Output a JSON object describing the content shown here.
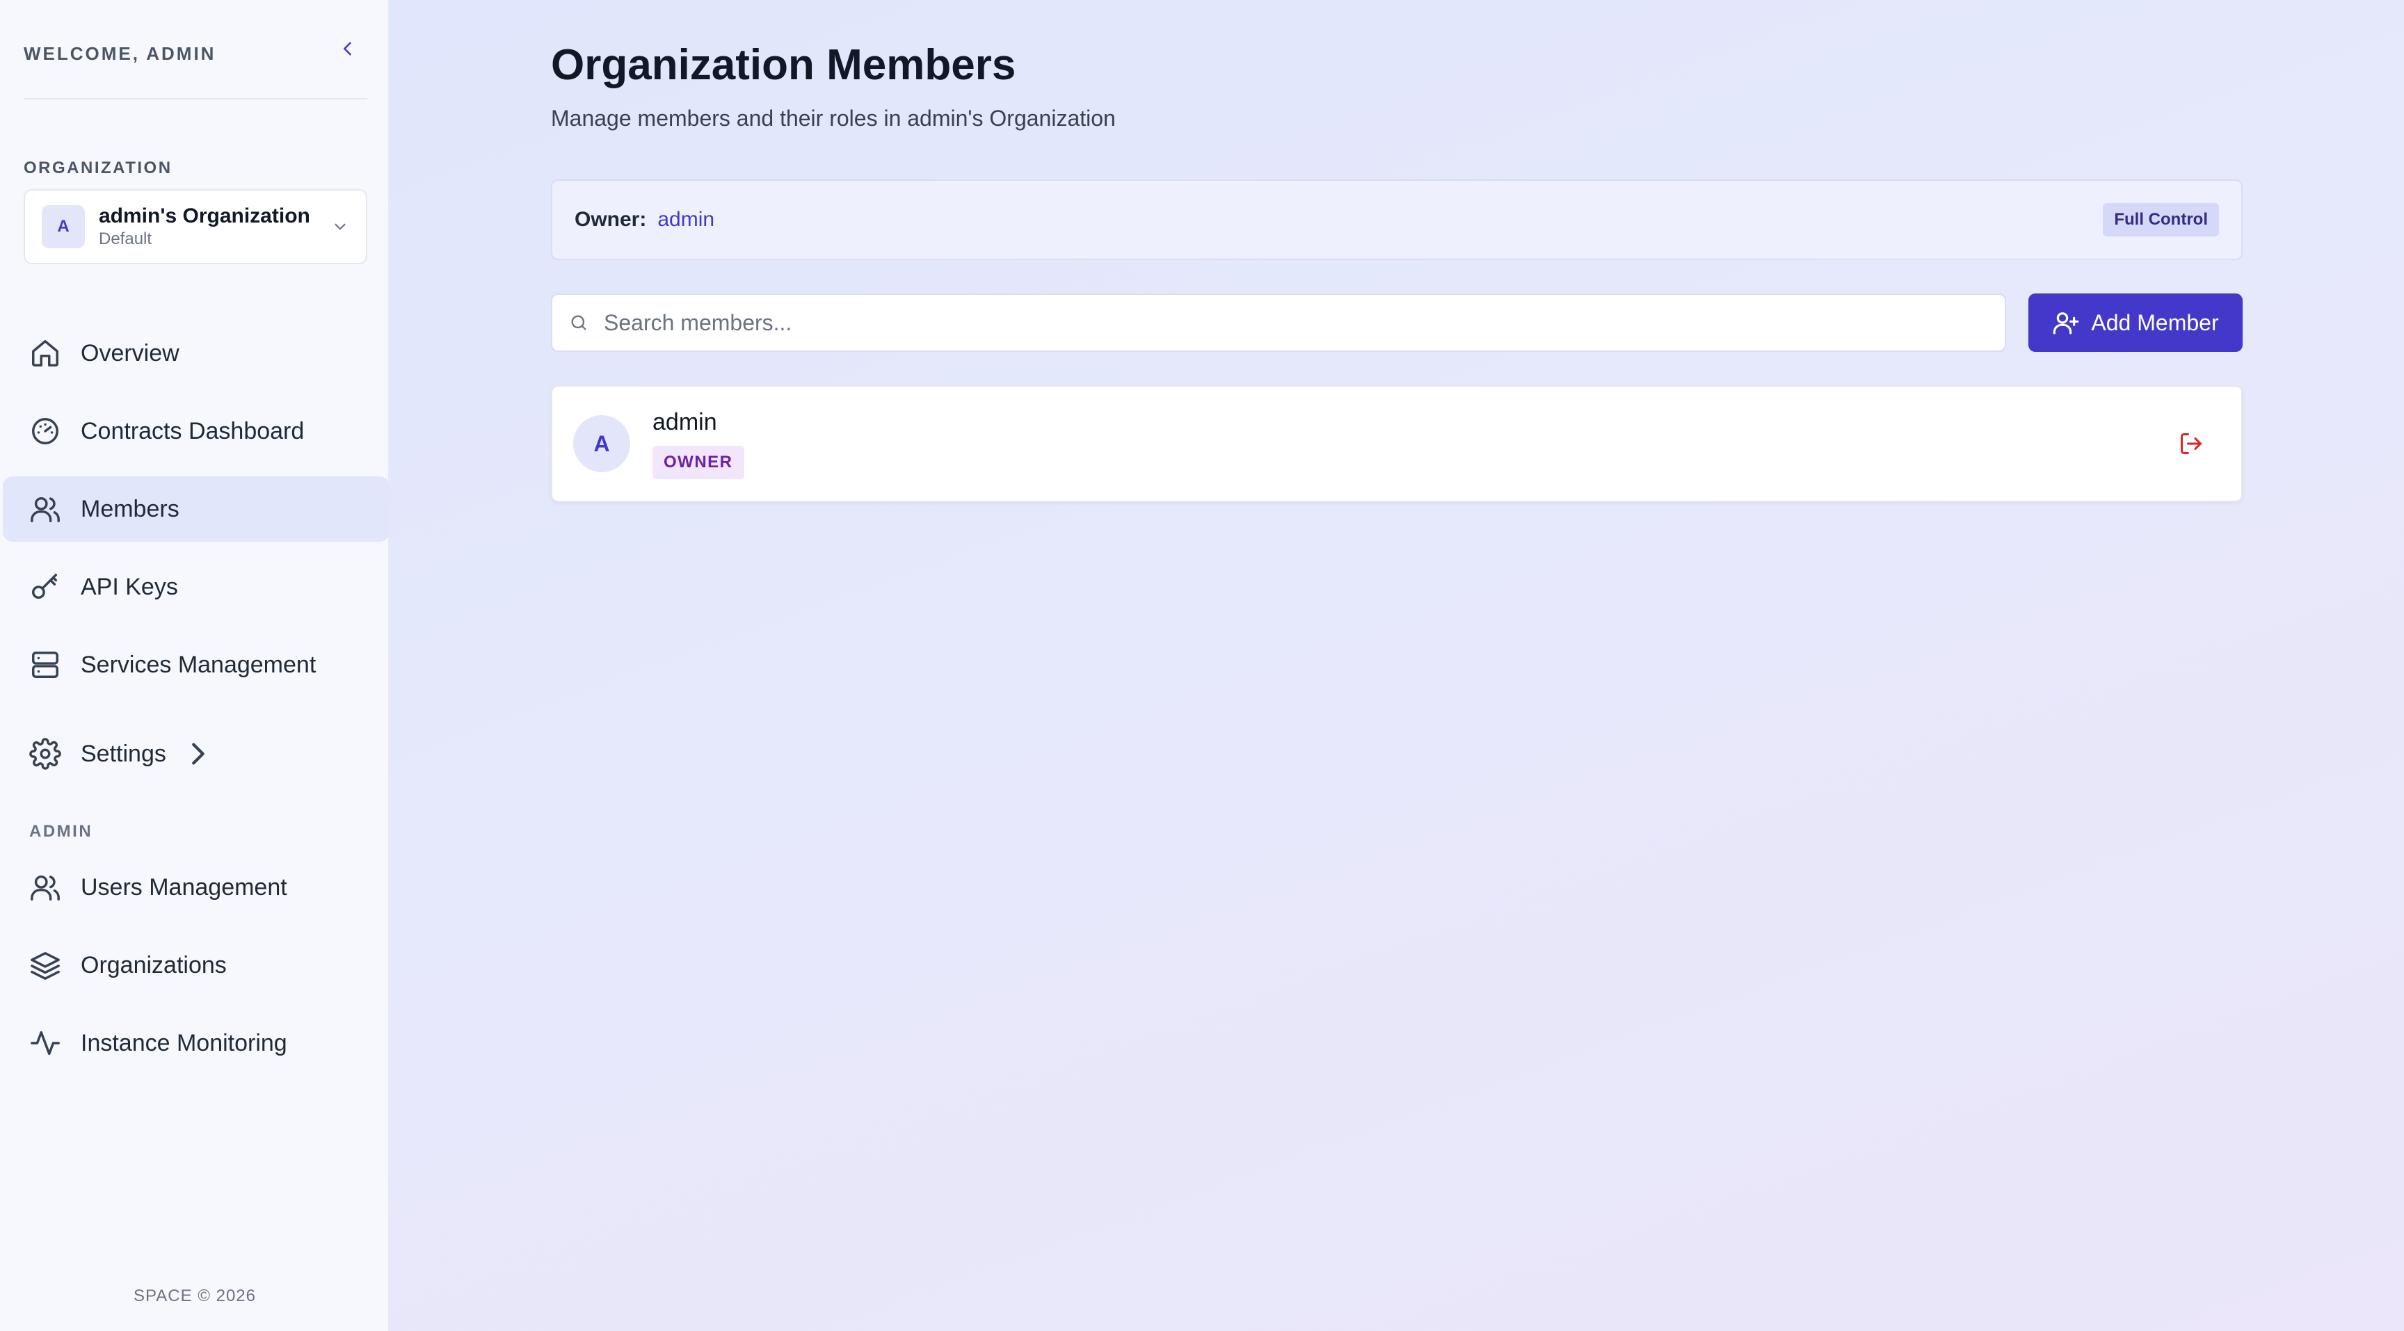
{
  "sidebar": {
    "welcome": "WELCOME, ADMIN",
    "organization_label": "ORGANIZATION",
    "organization": {
      "avatar_letter": "A",
      "name": "admin's Organization",
      "sub": "Default"
    },
    "nav": [
      {
        "label": "Overview",
        "icon": "home-icon"
      },
      {
        "label": "Contracts Dashboard",
        "icon": "gauge-icon"
      },
      {
        "label": "Members",
        "icon": "users-icon",
        "active": true
      },
      {
        "label": "API Keys",
        "icon": "key-icon"
      },
      {
        "label": "Services Management",
        "icon": "server-icon"
      },
      {
        "label": "Settings",
        "icon": "gear-icon"
      }
    ],
    "admin_label": "ADMIN",
    "admin_nav": [
      {
        "label": "Users Management",
        "icon": "users-icon"
      },
      {
        "label": "Organizations",
        "icon": "layers-icon"
      },
      {
        "label": "Instance Monitoring",
        "icon": "activity-icon"
      }
    ],
    "footer": "SPACE © 2026"
  },
  "main": {
    "title": "Organization Members",
    "subtitle": "Manage members and their roles in admin's Organization",
    "owner": {
      "label": "Owner:",
      "value": "admin",
      "badge": "Full Control"
    },
    "search": {
      "placeholder": "Search members...",
      "value": ""
    },
    "add_button": "Add Member",
    "members": [
      {
        "avatar_letter": "A",
        "name": "admin",
        "role": "OWNER"
      }
    ]
  },
  "colors": {
    "accent": "#4338ca",
    "danger": "#dc2626",
    "role_badge_bg": "#f1e6fb",
    "role_badge_text": "#6b21a8"
  }
}
